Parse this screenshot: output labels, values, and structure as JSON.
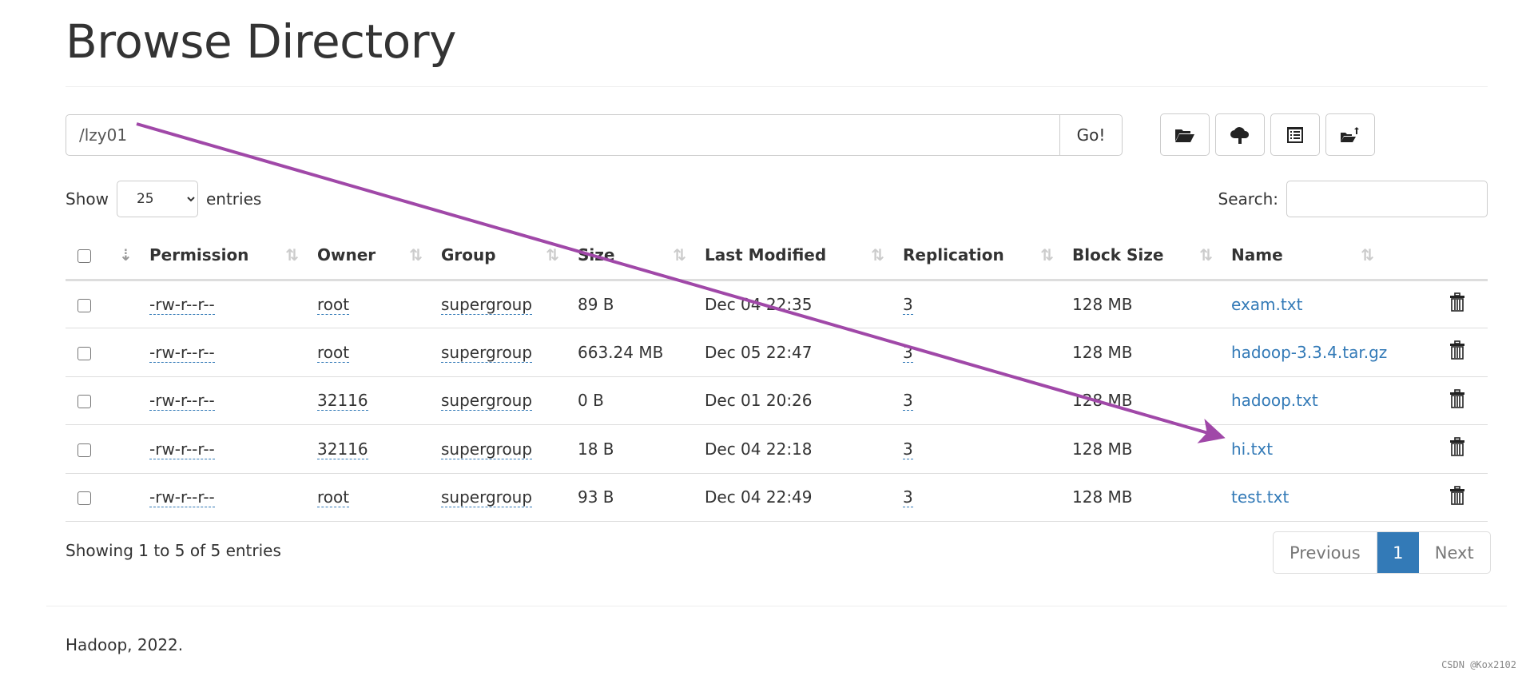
{
  "title": "Browse Directory",
  "path": {
    "value": "/lzy01",
    "go_label": "Go!"
  },
  "toolbar": [
    {
      "icon": "folder-open-icon"
    },
    {
      "icon": "cloud-upload-icon"
    },
    {
      "icon": "list-alt-icon"
    },
    {
      "icon": "folder-move-icon"
    }
  ],
  "show": {
    "prefix": "Show",
    "value": "25",
    "suffix": "entries"
  },
  "search": {
    "label": "Search:",
    "value": ""
  },
  "columns": [
    "Permission",
    "Owner",
    "Group",
    "Size",
    "Last Modified",
    "Replication",
    "Block Size",
    "Name"
  ],
  "rows": [
    {
      "permission": "-rw-r--r--",
      "owner": "root",
      "group": "supergroup",
      "size": "89 B",
      "modified": "Dec 04 22:35",
      "replication": "3",
      "block": "128 MB",
      "name": "exam.txt"
    },
    {
      "permission": "-rw-r--r--",
      "owner": "root",
      "group": "supergroup",
      "size": "663.24 MB",
      "modified": "Dec 05 22:47",
      "replication": "3",
      "block": "128 MB",
      "name": "hadoop-3.3.4.tar.gz"
    },
    {
      "permission": "-rw-r--r--",
      "owner": "32116",
      "group": "supergroup",
      "size": "0 B",
      "modified": "Dec 01 20:26",
      "replication": "3",
      "block": "128 MB",
      "name": "hadoop.txt"
    },
    {
      "permission": "-rw-r--r--",
      "owner": "32116",
      "group": "supergroup",
      "size": "18 B",
      "modified": "Dec 04 22:18",
      "replication": "3",
      "block": "128 MB",
      "name": "hi.txt"
    },
    {
      "permission": "-rw-r--r--",
      "owner": "root",
      "group": "supergroup",
      "size": "93 B",
      "modified": "Dec 04 22:49",
      "replication": "3",
      "block": "128 MB",
      "name": "test.txt"
    }
  ],
  "info": "Showing 1 to 5 of 5 entries",
  "pagination": {
    "previous": "Previous",
    "current": "1",
    "next": "Next"
  },
  "footer": "Hadoop, 2022.",
  "watermark": "CSDN @Kox2102",
  "colors": {
    "link": "#337ab7",
    "annotation_arrow": "#a048a8"
  }
}
